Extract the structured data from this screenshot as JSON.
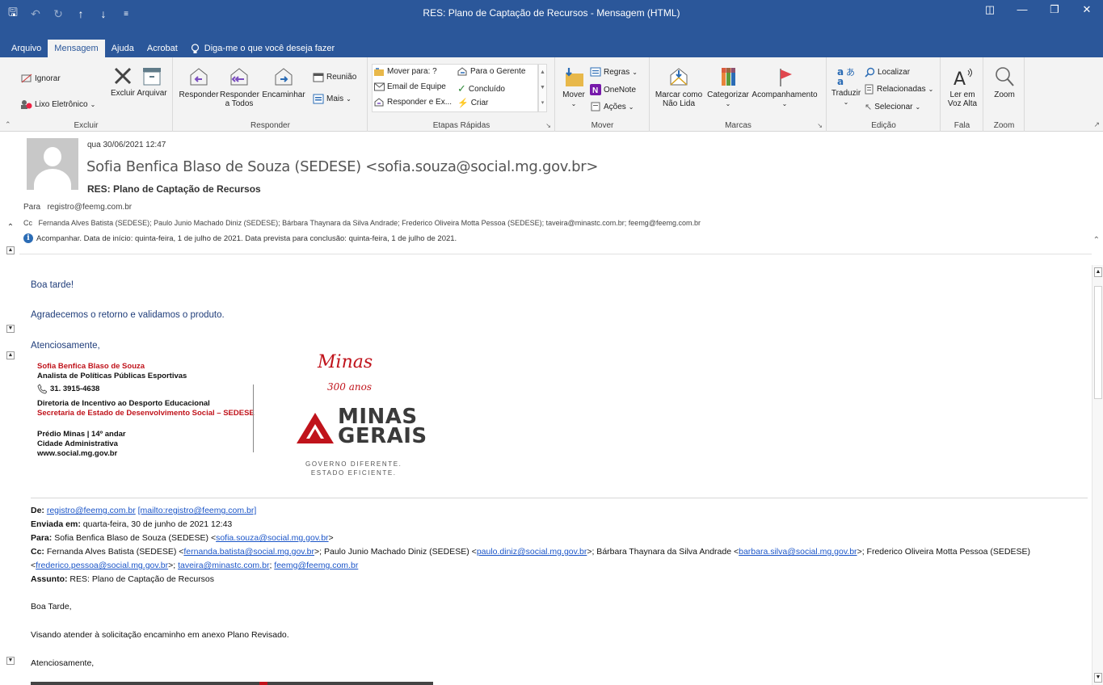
{
  "window": {
    "title": "RES: Plano de Captação de Recursos  -  Mensagem (HTML)"
  },
  "tabs": [
    "Arquivo",
    "Mensagem",
    "Ajuda",
    "Acrobat"
  ],
  "active_tab": "Mensagem",
  "tellme": "Diga-me o que você deseja fazer",
  "ribbon": {
    "excluir": {
      "ignorar": "Ignorar",
      "lixo": "Lixo Eletrônico",
      "excluir": "Excluir",
      "arquivar": "Arquivar",
      "label": "Excluir"
    },
    "responder": {
      "responder": "Responder",
      "responder_todos_1": "Responder",
      "responder_todos_2": "a Todos",
      "encaminhar": "Encaminhar",
      "reuniao": "Reunião",
      "mais": "Mais",
      "label": "Responder"
    },
    "etapas": {
      "mover_para": "Mover para: ?",
      "email_equipe": "Email de Equipe",
      "responder_ex": "Responder e Ex...",
      "para_gerente": "Para o Gerente",
      "concluido": "Concluído",
      "criar": "Criar",
      "label": "Etapas Rápidas"
    },
    "mover": {
      "mover": "Mover",
      "regras": "Regras",
      "onenote": "OneNote",
      "acoes": "Ações",
      "label": "Mover"
    },
    "marcas": {
      "marcar_1": "Marcar como",
      "marcar_2": "Não Lida",
      "categorizar": "Categorizar",
      "acompanhamento": "Acompanhamento",
      "label": "Marcas"
    },
    "edicao": {
      "traduzir": "Traduzir",
      "localizar": "Localizar",
      "relacionadas": "Relacionadas",
      "selecionar": "Selecionar",
      "label": "Edição"
    },
    "fala": {
      "ler_1": "Ler em",
      "ler_2": "Voz Alta",
      "label": "Fala"
    },
    "zoom": {
      "zoom": "Zoom",
      "label": "Zoom"
    }
  },
  "header": {
    "date": "qua 30/06/2021 12:47",
    "sender": "Sofia Benfica Blaso de Souza (SEDESE) <sofia.souza@social.mg.gov.br>",
    "subject": "RES: Plano de Captação de Recursos",
    "to_label": "Para",
    "to": "registro@feemg.com.br",
    "cc_label": "Cc",
    "cc": "Fernanda Alves Batista (SEDESE); Paulo Junio Machado Diniz (SEDESE); Bárbara Thaynara da Silva Andrade; Frederico Oliveira Motta Pessoa (SEDESE); taveira@minastc.com.br; feemg@feemg.com.br",
    "info": "Acompanhar.  Data de início: quinta-feira, 1 de julho de 2021.  Data prevista para conclusão: quinta-feira, 1 de julho de 2021."
  },
  "body": {
    "greeting": "Boa tarde!",
    "line1": "Agradecemos o retorno e validamos o produto.",
    "closing": "Atenciosamente,",
    "signature": {
      "name": "Sofia Benfica Blaso de Souza",
      "role": "Analista de Políticas Públicas Esportivas",
      "phone": "31. 3915-4638",
      "dept": "Diretoria de Incentivo ao Desporto Educacional",
      "secretaria": "Secretaria de Estado de Desenvolvimento Social – SEDESE",
      "addr1": "Prédio Minas | 14º andar",
      "addr2": "Cidade Administrativa",
      "site": "www.social.mg.gov.br"
    },
    "logo": {
      "script": "Minas",
      "years": "300 anos",
      "mg1": "MINAS",
      "mg2": "GERAIS",
      "sub1": "GOVERNO DIFERENTE.",
      "sub2": "ESTADO EFICIENTE."
    },
    "forward": {
      "de_label": "De:",
      "de_email": "registro@feemg.com.br",
      "de_mailto": "[mailto:registro@feemg.com.br]",
      "enviada_label": "Enviada em:",
      "enviada": "quarta-feira, 30 de junho de 2021 12:43",
      "para_label": "Para:",
      "para_name": "Sofia Benfica Blaso de Souza (SEDESE) <",
      "para_email": "sofia.souza@social.mg.gov.br",
      "cc_label": "Cc:",
      "cc_1": "Fernanda Alves Batista (SEDESE) <",
      "cc_1_email": "fernanda.batista@social.mg.gov.br",
      "cc_2": ">; Paulo Junio Machado Diniz (SEDESE) <",
      "cc_2_email": "paulo.diniz@social.mg.gov.br",
      "cc_3": ">; Bárbara Thaynara da Silva Andrade <",
      "cc_3_email": "barbara.silva@social.mg.gov.br",
      "cc_4": ">; Frederico Oliveira Motta Pessoa (SEDESE)",
      "cc_4_email": "frederico.pessoa@social.mg.gov.br",
      "cc_5_email": "taveira@minastc.com.br",
      "cc_6_email": "feemg@feemg.com.br",
      "assunto_label": "Assunto:",
      "assunto": "RES: Plano de Captação de Recursos",
      "greeting": "Boa Tarde,",
      "text": "Visando atender à solicitação encaminho em anexo Plano Revisado.",
      "closing": "Atenciosamente,"
    }
  }
}
